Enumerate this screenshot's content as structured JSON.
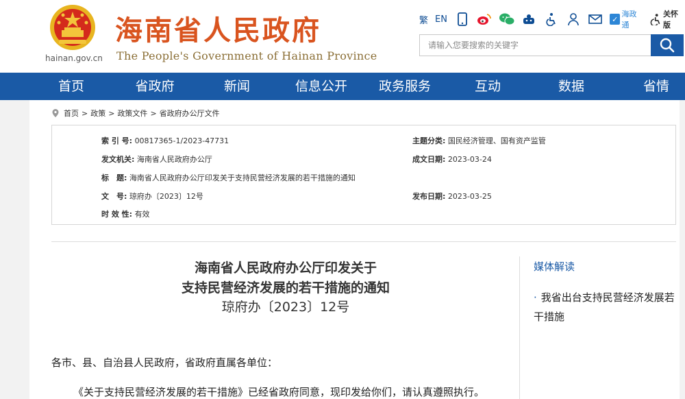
{
  "header": {
    "domain": "hainan.gov.cn",
    "title": "海南省人民政府",
    "subtitle": "The People's Government  of Hainan Province"
  },
  "tools": {
    "traditional": "繁",
    "english": "EN",
    "hzt_label": "海政通",
    "care_label": "关怀版"
  },
  "search": {
    "placeholder": "请输入您要搜索的关键字"
  },
  "nav": [
    "首页",
    "省政府",
    "新闻",
    "信息公开",
    "政务服务",
    "互动",
    "数据",
    "省情"
  ],
  "breadcrumb": [
    "首页",
    "政策",
    "政策文件",
    "省政府办公厅文件"
  ],
  "meta": {
    "index_label": "索 引 号:",
    "index_value": "00817365-1/2023-47731",
    "topic_label": "主题分类:",
    "topic_value": "国民经济管理、国有资产监管",
    "issuer_label": "发文机关:",
    "issuer_value": "海南省人民政府办公厅",
    "date_label": "成文日期:",
    "date_value": "2023-03-24",
    "title_label": "标　题:",
    "title_value": "海南省人民政府办公厅印发关于支持民营经济发展的若干措施的通知",
    "docno_label": "文　号:",
    "docno_value": "琼府办〔2023〕12号",
    "pub_label": "发布日期:",
    "pub_value": "2023-03-25",
    "validity_label": "时 效 性:",
    "validity_value": "有效"
  },
  "article": {
    "title_line1": "海南省人民政府办公厅印发关于",
    "title_line2": "支持民营经济发展的若干措施的通知",
    "doc_number": "琼府办〔2023〕12号",
    "salutation": "各市、县、自治县人民政府，省政府直属各单位：",
    "body_start": "《关于支持民营经济发展的若干措施》已经省政府同意，现印发给你们，请认真遵照执行。"
  },
  "sidebar": {
    "heading": "媒体解读",
    "link": "我省出台支持民营经济发展若干措施"
  }
}
